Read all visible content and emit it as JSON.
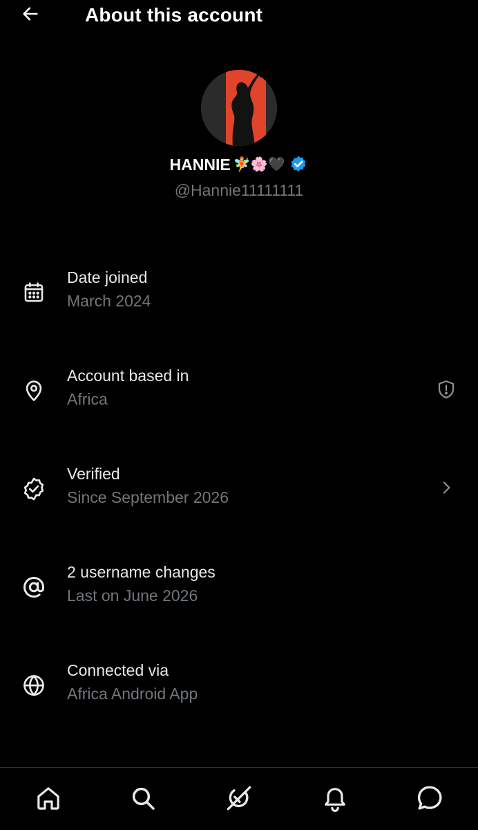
{
  "header": {
    "title": "About this account",
    "back_icon": "arrow-left-icon"
  },
  "profile": {
    "display_name": "HANNIE",
    "name_emojis": "🧚🌸🖤",
    "verified_badge_color": "#1d9bf0",
    "handle": "@Hannie11111111",
    "avatar_colors": {
      "background": "#2b2b2b",
      "accent": "#e0442a"
    }
  },
  "rows": [
    {
      "icon": "calendar-icon",
      "title": "Date joined",
      "subtitle": "March 2024"
    },
    {
      "icon": "location-pin-icon",
      "title": "Account based in",
      "subtitle": "Africa",
      "trailing_icon": "shield-alert-icon"
    },
    {
      "icon": "verified-check-icon",
      "title": "Verified",
      "subtitle": "Since September 2026",
      "trailing_icon": "chevron-right-icon"
    },
    {
      "icon": "at-sign-icon",
      "title": "2 username changes",
      "subtitle": "Last on June 2026"
    },
    {
      "icon": "globe-icon",
      "title": "Connected via",
      "subtitle": "Africa Android App"
    }
  ],
  "bottom_nav": [
    {
      "name": "home",
      "icon": "home-icon"
    },
    {
      "name": "search",
      "icon": "search-icon"
    },
    {
      "name": "grok",
      "icon": "grok-icon"
    },
    {
      "name": "notifications",
      "icon": "bell-icon"
    },
    {
      "name": "messages",
      "icon": "message-bubble-icon"
    }
  ],
  "colors": {
    "background": "#000000",
    "primary_text": "#e7e9ea",
    "secondary_text": "#71767b",
    "divider": "#2f3336"
  }
}
